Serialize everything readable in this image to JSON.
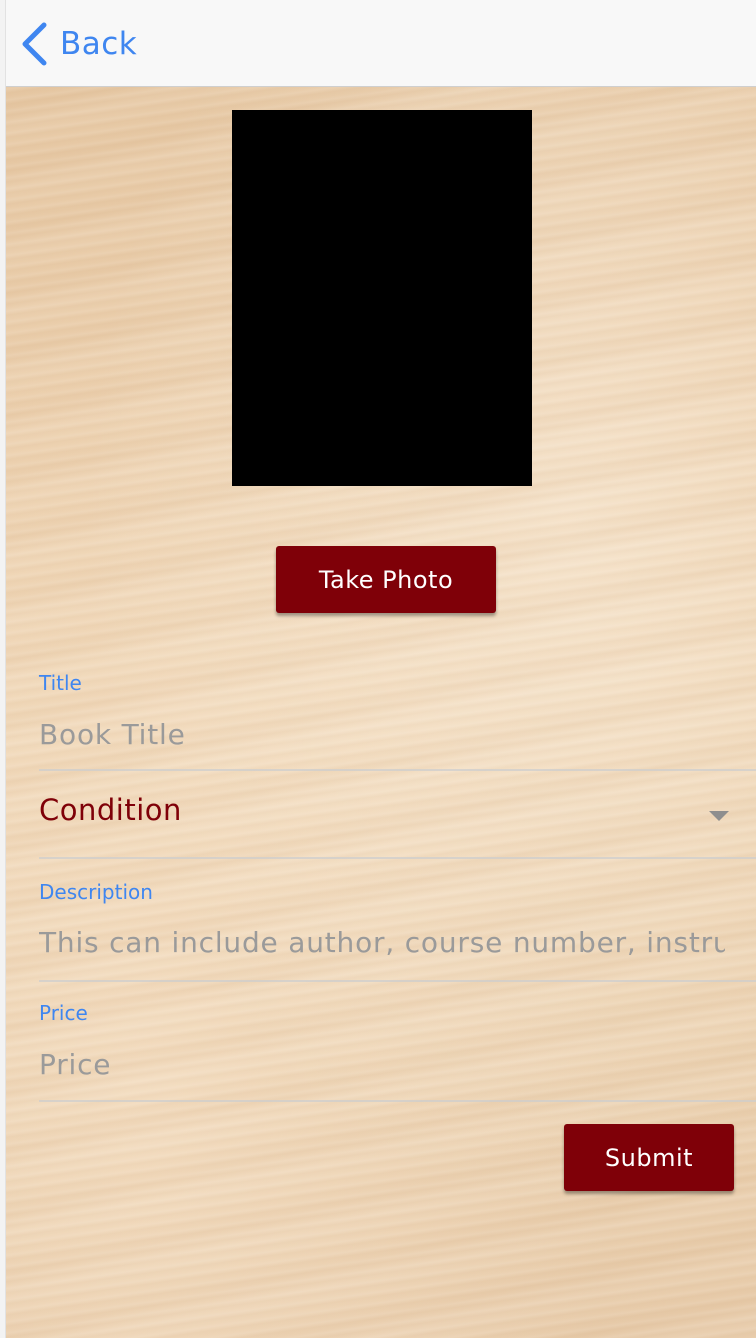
{
  "nav": {
    "back_label": "Back"
  },
  "buttons": {
    "take_photo": "Take Photo",
    "submit": "Submit"
  },
  "fields": {
    "title": {
      "label": "Title",
      "placeholder": "Book Title"
    },
    "condition": {
      "label": "Condition"
    },
    "description": {
      "label": "Description",
      "placeholder": "This can include author, course number, instru"
    },
    "price": {
      "label": "Price",
      "placeholder": "Price"
    }
  },
  "colors": {
    "accent_blue": "#3f86f0",
    "button_maroon": "#7f0008",
    "placeholder_gray": "#9a9a9a"
  },
  "icons": {
    "back": "chevron-left-icon",
    "dropdown": "caret-down-icon"
  }
}
